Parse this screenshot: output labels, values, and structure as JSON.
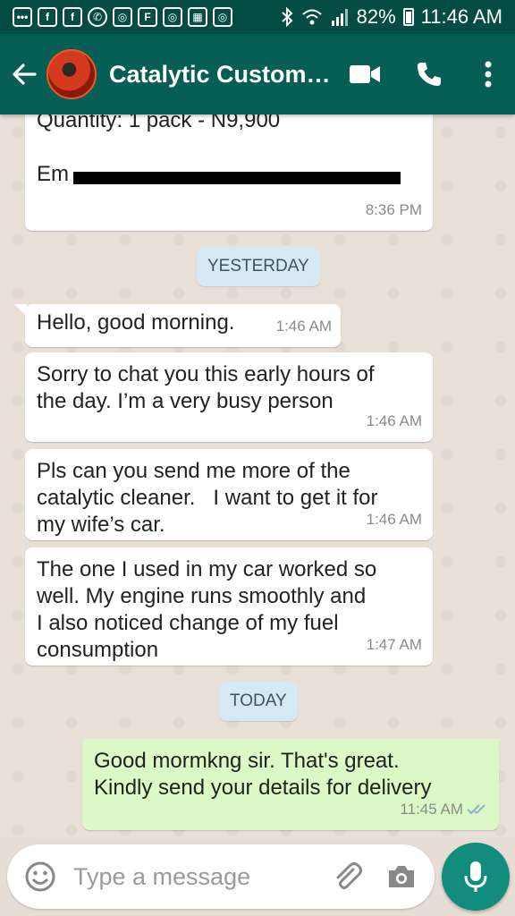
{
  "status_bar": {
    "notification_icons": [
      "whatsapp-icon",
      "facebook-icon",
      "facebook-icon",
      "whatsapp-icon",
      "instagram-icon",
      "flipboard-icon",
      "instagram-icon",
      "calendar-icon",
      "instagram-icon"
    ],
    "battery": "82%",
    "time": "11:46 AM"
  },
  "header": {
    "contact_name": "Catalytic Custom…"
  },
  "messages": {
    "m0": {
      "text": "Quantity: 1 pack - N9,900\n\nEm",
      "time": "8:36 PM"
    },
    "m1": {
      "text": "Hello, good morning.",
      "time": "1:46 AM"
    },
    "m2": {
      "text": "Sorry to chat you this early hours of\nthe day. I’m a very busy person",
      "time": "1:46 AM"
    },
    "m3": {
      "text": "Pls can you send me more of the\ncatalytic cleaner.   I want to get it for\nmy wife’s car.",
      "time": "1:46 AM"
    },
    "m4": {
      "text": "The one I used in my car worked so\nwell. My engine runs smoothly and\nI also noticed change of my fuel\nconsumption",
      "time": "1:47 AM"
    },
    "m5": {
      "text": "Good mormkng sir. That's great.\nKindly send your details for delivery",
      "time": "11:45 AM"
    }
  },
  "dates": {
    "yesterday": "YESTERDAY",
    "today": "TODAY"
  },
  "input": {
    "placeholder": "Type a message"
  },
  "colors": {
    "app_bar": "#075e54",
    "status_bar": "#054d44",
    "outgoing_bubble": "#dcf8c6",
    "incoming_bubble": "#ffffff",
    "fab": "#128c7e",
    "read_ticks": "#8ab4c8"
  }
}
